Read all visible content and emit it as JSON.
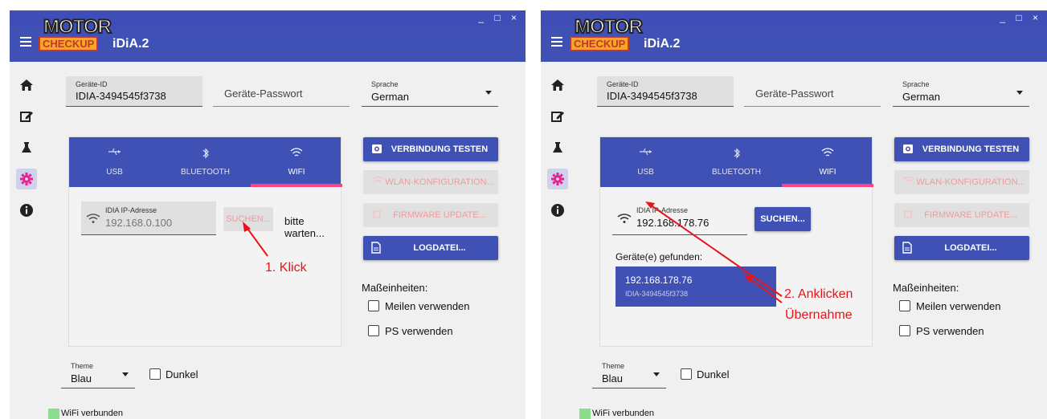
{
  "app": {
    "title": "iDiA.2",
    "logo_top": "MOTOR",
    "logo_bottom": "CHECKUP",
    "window_controls": "_ □ ×"
  },
  "colors": {
    "primary": "#3f51b5",
    "accent": "#ff4081",
    "annotation": "#e8141a",
    "status_ok": "#8bde8b"
  },
  "sidebar": {
    "items": [
      {
        "name": "home",
        "icon": "home-icon"
      },
      {
        "name": "edit",
        "icon": "edit-icon"
      },
      {
        "name": "lab",
        "icon": "flask-icon"
      },
      {
        "name": "settings",
        "icon": "gear-icon",
        "active": true
      },
      {
        "name": "info",
        "icon": "info-icon"
      }
    ]
  },
  "settings": {
    "device_id_label": "Geräte-ID",
    "device_id_value": "IDIA-3494545f3738",
    "password_placeholder": "Geräte-Passwort",
    "language_label": "Sprache",
    "language_value": "German",
    "tabs": [
      {
        "label": "USB",
        "icon": "usb-icon"
      },
      {
        "label": "BLUETOOTH",
        "icon": "bluetooth-icon"
      },
      {
        "label": "WIFI",
        "icon": "wifi-icon",
        "active": true
      }
    ],
    "ip_label": "IDIA IP-Adresse",
    "search_button": "SUCHEN...",
    "buttons": {
      "test_connection": "VERBINDUNG TESTEN",
      "wlan_config": "WLAN-KONFIGURATION...",
      "firmware_update": "FIRMWARE UPDATE...",
      "logfile": "LOGDATEI..."
    },
    "units_label": "Maßeinheiten:",
    "use_miles": "Meilen verwenden",
    "use_ps": "PS verwenden",
    "theme_label": "Theme",
    "theme_value": "Blau",
    "dark_label": "Dunkel",
    "status_text": "WiFi verbunden"
  },
  "left_panel": {
    "ip_value": "192.168.0.100",
    "waiting_text": "bitte warten...",
    "annotation": "1. Klick"
  },
  "right_panel": {
    "ip_value": "192.168.178.76",
    "found_label": "Geräte(e) gefunden:",
    "found_ip": "192.168.178.76",
    "found_id": "IDIA-3494545f3738",
    "annotation_line1": "2. Anklicken",
    "annotation_line2": "Übernahme"
  }
}
